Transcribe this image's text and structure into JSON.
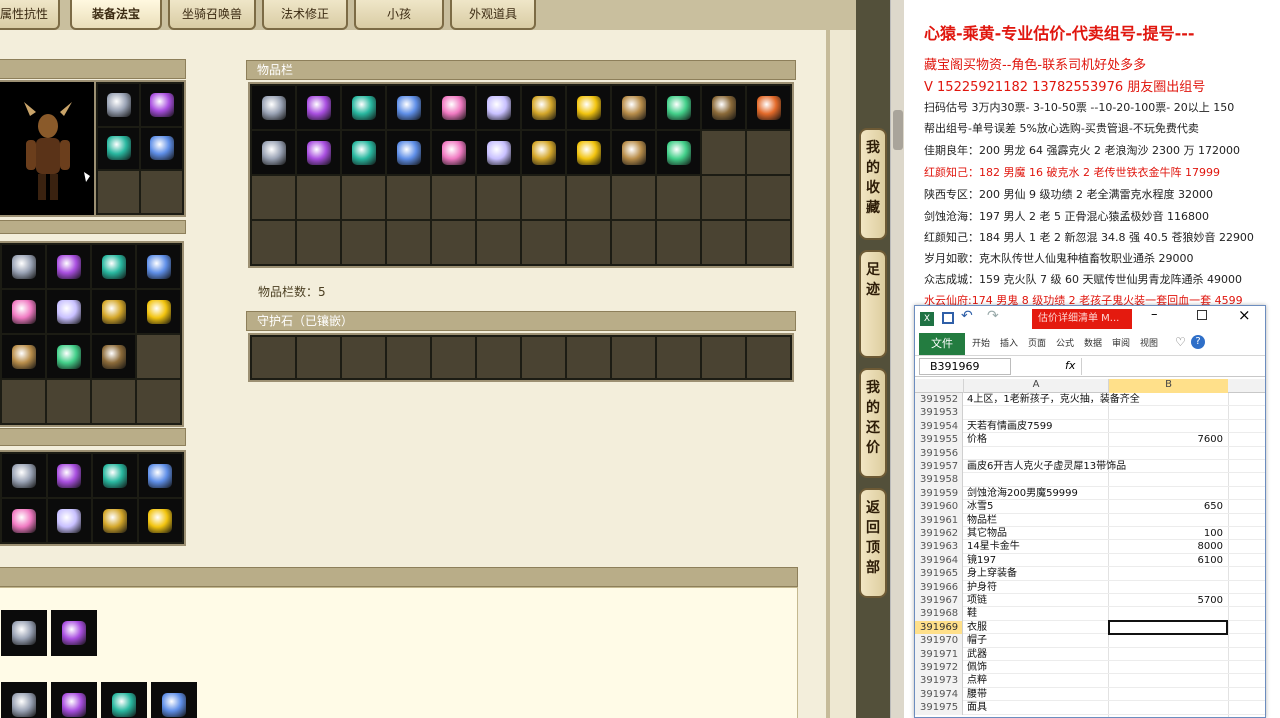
{
  "game": {
    "tabs": [
      "属性抗性",
      "装备法宝",
      "坐骑召唤兽",
      "法术修正",
      "小孩",
      "外观道具"
    ],
    "active_tab": "装备法宝",
    "inventory": {
      "title": "物品栏",
      "count_label": "物品栏数：5"
    },
    "guard_stone": {
      "title": "守护石（已镶嵌）"
    },
    "side_buttons": [
      "我的收藏",
      "足迹",
      "我的还价",
      "返回顶部"
    ],
    "colors": {
      "panel_head": "#b9ad88",
      "slot": "#4a4332",
      "accent_red": "#e0160e"
    }
  },
  "notes": {
    "lines": [
      "心猿-乘黄-专业估价-代卖组号-提号---",
      "藏宝阁买物资--角色-联系司机好处多多",
      "V 15225921182   13782553976 朋友圈出组号",
      "扫码估号 3万内30票- 3-10-50票  --10-20-100票- 20以上 150",
      "帮出组号-单号误差 5%放心选购-买贵管退-不玩免费代卖",
      "佳期良年：200 男龙 64 强霹克火 2 老浪淘沙 2300 万 172000",
      "红颜知己：182 男魔 16 破克水 2 老传世铁衣金牛阵 17999",
      "陕西专区：200 男仙 9 级功绩 2 老全满雷克水程度 32000",
      "剑蚀沧海：197 男人 2 老 5 正骨混心猿孟极妙音 116800",
      "红颜知己：184 男人 1 老 2 新忽混 34.8 强 40.5 苍狼妙音 22900",
      "岁月如歌：克木队传世人仙鬼种植畜牧职业通杀 29000",
      "众志成城：159 克火队 7 级 60 天赋传世仙男青龙阵通杀 49000",
      "水云仙府:174 男鬼 8 级功绩 2 老孩子鬼火装一套回血一套 4599"
    ]
  },
  "excel": {
    "title": "估价详细清单 M...",
    "ribbon": {
      "file": "文件",
      "tabs": [
        "开始",
        "插入",
        "页面",
        "公式",
        "数据",
        "审阅",
        "视图"
      ]
    },
    "name_box": "B391969",
    "fx": "fx",
    "columns": [
      "A",
      "B"
    ],
    "selected_row": "391969",
    "rows": [
      {
        "n": "391952",
        "a": "4上区，1老新孩子，克火抽，装备齐全",
        "b": ""
      },
      {
        "n": "391953",
        "a": "",
        "b": ""
      },
      {
        "n": "391954",
        "a": "天若有情画皮7599",
        "b": ""
      },
      {
        "n": "391955",
        "a": "价格",
        "b": "7600"
      },
      {
        "n": "391956",
        "a": "",
        "b": ""
      },
      {
        "n": "391957",
        "a": "画皮6开吉人克火子虚灵犀13带饰品",
        "b": ""
      },
      {
        "n": "391958",
        "a": "",
        "b": ""
      },
      {
        "n": "391959",
        "a": "剑蚀沧海200男魔59999",
        "b": ""
      },
      {
        "n": "391960",
        "a": "冰雪5",
        "b": "650"
      },
      {
        "n": "391961",
        "a": "物品栏",
        "b": ""
      },
      {
        "n": "391962",
        "a": "其它物品",
        "b": "100"
      },
      {
        "n": "391963",
        "a": "14星卡金牛",
        "b": "8000"
      },
      {
        "n": "391964",
        "a": "镜197",
        "b": "6100"
      },
      {
        "n": "391965",
        "a": "身上穿装备",
        "b": ""
      },
      {
        "n": "391966",
        "a": "护身符",
        "b": ""
      },
      {
        "n": "391967",
        "a": "项链",
        "b": "5700"
      },
      {
        "n": "391968",
        "a": "鞋",
        "b": ""
      },
      {
        "n": "391969",
        "a": "衣服",
        "b": ""
      },
      {
        "n": "391970",
        "a": "帽子",
        "b": ""
      },
      {
        "n": "391971",
        "a": "武器",
        "b": ""
      },
      {
        "n": "391972",
        "a": "佩饰",
        "b": ""
      },
      {
        "n": "391973",
        "a": "点粹",
        "b": ""
      },
      {
        "n": "391974",
        "a": "腰带",
        "b": ""
      },
      {
        "n": "391975",
        "a": "面具",
        "b": ""
      }
    ]
  }
}
